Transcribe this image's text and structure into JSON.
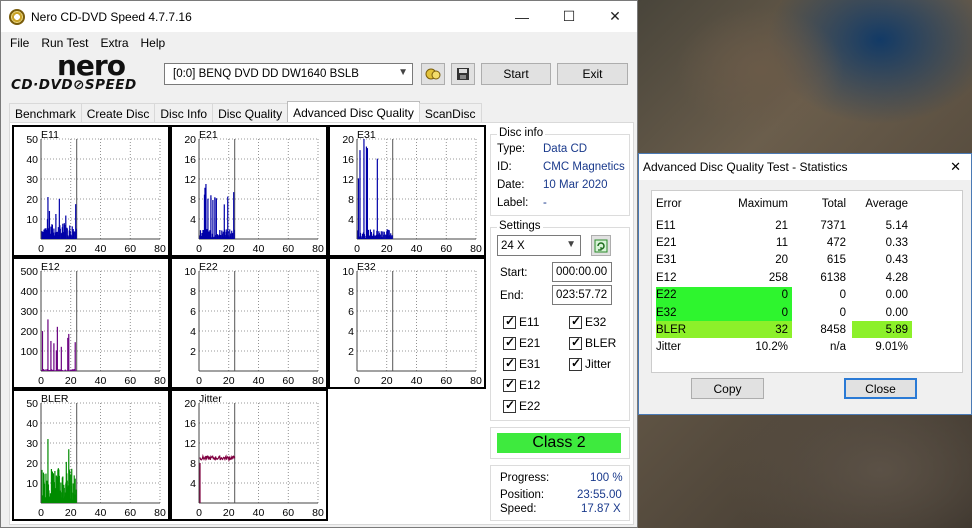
{
  "main_window": {
    "title": "Nero CD-DVD Speed 4.7.7.16",
    "controls": {
      "minimize": "—",
      "maximize": "☐",
      "close": "✕"
    }
  },
  "menu": [
    "File",
    "Run Test",
    "Extra",
    "Help"
  ],
  "logo": {
    "brand": "nero",
    "product": "CD·DVD⊘SPEED"
  },
  "toolbar": {
    "drive": "[0:0]   BENQ DVD DD DW1640 BSLB",
    "start_label": "Start",
    "exit_label": "Exit"
  },
  "tabs": [
    "Benchmark",
    "Create Disc",
    "Disc Info",
    "Disc Quality",
    "Advanced Disc Quality",
    "ScanDisc"
  ],
  "active_tab": "Advanced Disc Quality",
  "charts": [
    {
      "name": "E11",
      "yticks": [
        "50",
        "40",
        "30",
        "20",
        "10"
      ],
      "xticks": [
        "0",
        "20",
        "40",
        "60",
        "80"
      ],
      "color": "#0000a8",
      "ymax": 50
    },
    {
      "name": "E21",
      "yticks": [
        "20",
        "16",
        "12",
        "8",
        "4"
      ],
      "xticks": [
        "0",
        "20",
        "40",
        "60",
        "80"
      ],
      "color": "#0000a8",
      "ymax": 20
    },
    {
      "name": "E31",
      "yticks": [
        "20",
        "16",
        "12",
        "8",
        "4"
      ],
      "xticks": [
        "0",
        "20",
        "40",
        "60",
        "80"
      ],
      "color": "#0000a8",
      "ymax": 20
    },
    {
      "name": "E12",
      "yticks": [
        "500",
        "400",
        "300",
        "200",
        "100"
      ],
      "xticks": [
        "0",
        "20",
        "40",
        "60",
        "80"
      ],
      "color": "#6a0080",
      "ymax": 500
    },
    {
      "name": "E22",
      "yticks": [
        "10",
        "8",
        "6",
        "4",
        "2"
      ],
      "xticks": [
        "0",
        "20",
        "40",
        "60",
        "80"
      ],
      "color": "#6a0080",
      "ymax": 10
    },
    {
      "name": "E32",
      "yticks": [
        "10",
        "8",
        "6",
        "4",
        "2"
      ],
      "xticks": [
        "0",
        "20",
        "40",
        "60",
        "80"
      ],
      "color": "#6a0080",
      "ymax": 10
    },
    {
      "name": "BLER",
      "yticks": [
        "50",
        "40",
        "30",
        "20",
        "10"
      ],
      "xticks": [
        "0",
        "20",
        "40",
        "60",
        "80"
      ],
      "color": "#008c00",
      "ymax": 50
    },
    {
      "name": "Jitter",
      "yticks": [
        "20",
        "16",
        "12",
        "8",
        "4"
      ],
      "xticks": [
        "0",
        "20",
        "40",
        "60",
        "80"
      ],
      "color": "#800040",
      "ymax": 20
    }
  ],
  "disc_info": {
    "title": "Disc info",
    "type_label": "Type:",
    "type": "Data CD",
    "id_label": "ID:",
    "id": "CMC Magnetics",
    "date_label": "Date:",
    "date": "10 Mar 2020",
    "label_label": "Label:",
    "label": "-"
  },
  "settings": {
    "title": "Settings",
    "speed": "24 X",
    "start_label": "Start:",
    "start": "000:00.00",
    "end_label": "End:",
    "end": "023:57.72",
    "checks": [
      "E11",
      "E32",
      "E21",
      "BLER",
      "E31",
      "Jitter",
      "E12",
      "E22"
    ]
  },
  "class_label": "Class 2",
  "progress": {
    "progress_label": "Progress:",
    "progress": "100 %",
    "position_label": "Position:",
    "position": "23:55.00",
    "speed_label": "Speed:",
    "speed": "17.87 X"
  },
  "stats": {
    "title": "Advanced Disc Quality Test - Statistics",
    "headers": [
      "Error",
      "Maximum",
      "Total",
      "Average"
    ],
    "rows": [
      {
        "error": "E11",
        "maximum": "21",
        "total": "7371",
        "average": "5.14"
      },
      {
        "error": "E21",
        "maximum": "11",
        "total": "472",
        "average": "0.33"
      },
      {
        "error": "E31",
        "maximum": "20",
        "total": "615",
        "average": "0.43"
      },
      {
        "error": "E12",
        "maximum": "258",
        "total": "6138",
        "average": "4.28"
      },
      {
        "error": "E22",
        "maximum": "0",
        "total": "0",
        "average": "0.00"
      },
      {
        "error": "E32",
        "maximum": "0",
        "total": "0",
        "average": "0.00"
      },
      {
        "error": "BLER",
        "maximum": "32",
        "total": "8458",
        "average": "5.89"
      },
      {
        "error": "Jitter",
        "maximum": "10.2%",
        "total": "n/a",
        "average": "9.01%"
      }
    ],
    "copy_label": "Copy",
    "close_label": "Close",
    "highlight_green": "#2ef52e",
    "highlight_lime": "#8cf02a"
  }
}
